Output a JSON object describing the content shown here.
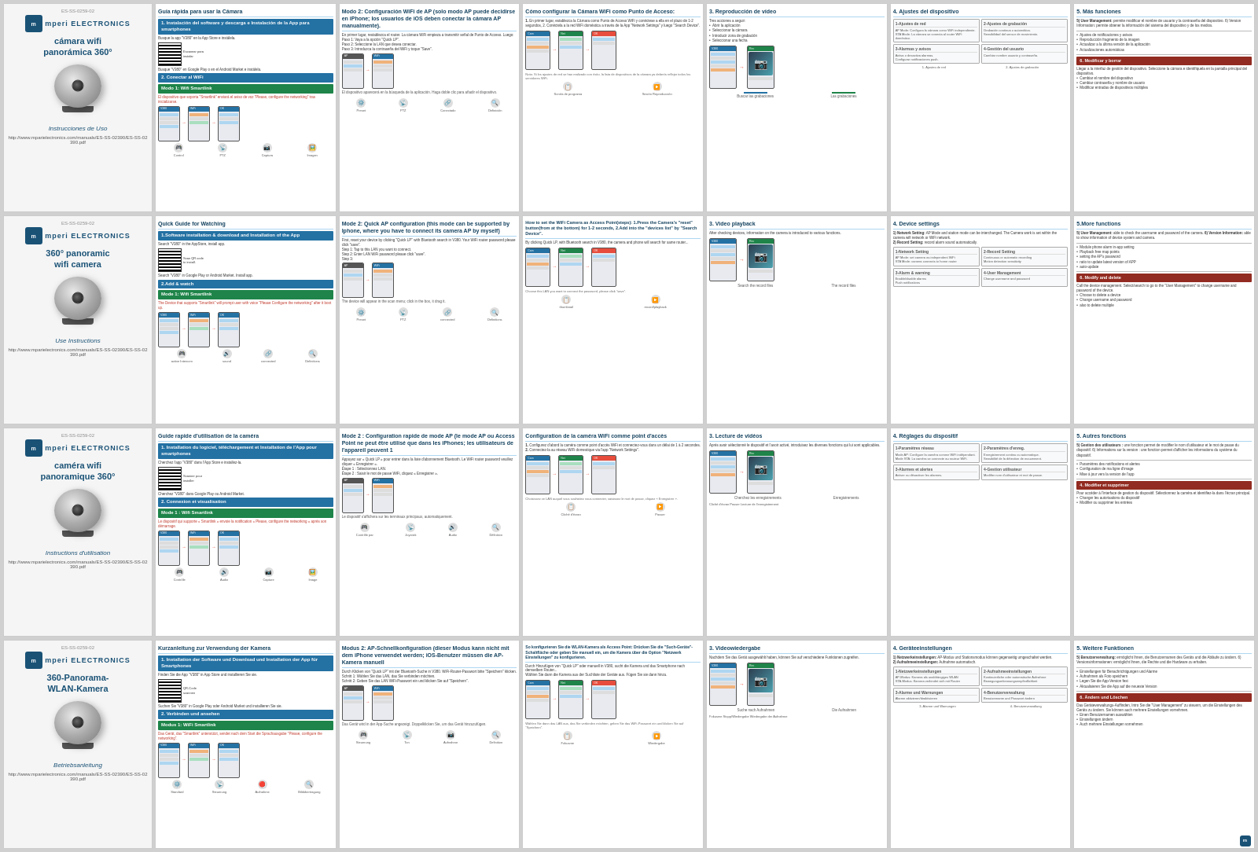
{
  "rows": [
    {
      "id": "row-spanish",
      "camera_panel": {
        "doc_id": "ES-SS-0259-02",
        "logo": "mperi ELECTRONICS",
        "title": "cámara wifi\npanorámica 360°",
        "instructions_label": "Instrucciones de Uso",
        "url": "http://www.mparielectronics.com/manuals/ES-SS-02390/ES-SS-02390.pdf"
      },
      "panels": [
        {
          "id": "panel-es-1",
          "title": "Guía rápida para usar la Cámara",
          "section1": "1. Instalación del software y descarga e Instalación de la App para smartphones",
          "section2": "2. Conectar al WiFi",
          "section3": "Modo 1: Wifi Smartlink",
          "content_type": "installation"
        },
        {
          "id": "panel-es-2",
          "title": "Modo 2: Configuración WiFi de AP (solo modo AP puede decidirse en iPhone; los usuarios de iOS deben conectar la cámara AP manualmente).",
          "content_type": "wifi-config"
        },
        {
          "id": "panel-es-3",
          "title": "Cómo configurar la Cámara WiFi como Punto de Acceso:",
          "content_type": "access-point"
        },
        {
          "id": "panel-es-4",
          "title": "3. Reproducción de vídeo",
          "subsections": [
            "Buscar las grabaciones",
            "Las grabaciones"
          ],
          "content_type": "video-playback"
        },
        {
          "id": "panel-es-5",
          "title": "4. Ajustes del dispositivo",
          "subsections": [
            "1-Ajustes de red",
            "2-Ajustes de grabación",
            "3-Alarmas y avisos",
            "4-Gestión del usuario"
          ],
          "content_type": "device-settings"
        },
        {
          "id": "panel-es-6",
          "title": "5. Más funciones",
          "content_type": "more-functions"
        }
      ]
    },
    {
      "id": "row-english",
      "camera_panel": {
        "doc_id": "ES-SS-0259-02",
        "logo": "mperi ELECTRONICS",
        "title": "360° panoramic\nwifi camera",
        "instructions_label": "Use Instructions",
        "url": "http://www.mparielectronics.com/manuals/ES-SS-02390/ES-SS-02390.pdf"
      },
      "panels": [
        {
          "id": "panel-en-1",
          "title": "Quick Guide for Watching",
          "section1": "1.Software installation & download and Installation of the App",
          "section2": "2.Add & watch",
          "section3": "Mode 1: Wifi Smartlink",
          "content_type": "installation-en"
        },
        {
          "id": "panel-en-2",
          "title": "Mode 2: Quick AP configuration (this mode can be supported by Iphone, where you have to connect its camera AP by myself)",
          "content_type": "wifi-config-en"
        },
        {
          "id": "panel-en-3",
          "title": "How to set the WiFi Camera as Access Point(steps): 1.Press the Camera's \"reset\" button(from at the bottom) for 1-2 seconds,  2.Add into the \"devices list\" by \"Search Device\".",
          "content_type": "access-point-en"
        },
        {
          "id": "panel-en-4",
          "title": "3. Video playback",
          "subsections": [
            "Search the record files",
            "The record files"
          ],
          "content_type": "video-playback-en"
        },
        {
          "id": "panel-en-5",
          "title": "4. Device settings",
          "subsections": [
            "1-Network Setting",
            "2-Record Setting",
            "3-Alarm & warning",
            "4-User Management"
          ],
          "content_type": "device-settings-en"
        },
        {
          "id": "panel-en-6",
          "title": "5.More functions",
          "content_type": "more-functions-en"
        }
      ]
    },
    {
      "id": "row-french",
      "camera_panel": {
        "doc_id": "ES-SS-0259-02",
        "logo": "mperi ELECTRONICS",
        "title": "caméra wifi\npanoramique 360°",
        "instructions_label": "Instructions d'utilisation",
        "url": "http://www.mparielectronics.com/manuals/ES-SS-02390/ES-SS-02390.pdf"
      },
      "panels": [
        {
          "id": "panel-fr-1",
          "title": "Guide rapide d'utilisation de la caméra",
          "section1": "1. Installation du logiciel, téléchargement et Installation de l'App pour smartphones",
          "section2": "2. Connexion et visualisation",
          "section3": "Mode 1 : Wifi Smartlink",
          "content_type": "installation-fr"
        },
        {
          "id": "panel-fr-2",
          "title": "Mode 2 : Configuration rapide de mode AP (le mode AP ou Access Point ne peut être utilisé que dans les iPhones; les utilisateurs de l'appareil peuvent 1",
          "content_type": "wifi-config-fr"
        },
        {
          "id": "panel-fr-3",
          "title": "Configuration de la caméra WiFi comme point d'accès",
          "content_type": "access-point-fr"
        },
        {
          "id": "panel-fr-4",
          "title": "3. Lecture de vidéos",
          "subsections": [
            "Cherchez les enregistrements",
            "Enregistrements"
          ],
          "content_type": "video-playback-fr"
        },
        {
          "id": "panel-fr-5",
          "title": "4. Réglages du dispositif",
          "subsections": [
            "1-Paramètres réseau",
            "2-Paramètres d'enregistrement",
            "3-Alarmes et alertes",
            "4-Gestion de l'utilisateur"
          ],
          "content_type": "device-settings-fr"
        },
        {
          "id": "panel-fr-6",
          "title": "5. Autres fonctions",
          "content_type": "more-functions-fr"
        }
      ]
    },
    {
      "id": "row-german",
      "camera_panel": {
        "doc_id": "ES-SS-0259-02",
        "logo": "mperi ELECTRONICS",
        "title": "360-Panorama-\nWLAN-Kamera",
        "instructions_label": "Betriebsanleitung",
        "url": "http://www.mparielectronics.com/manuals/ES-SS-02390/ES-SS-02390.pdf"
      },
      "panels": [
        {
          "id": "panel-de-1",
          "title": "Kurzanleitung zur Verwendung der Kamera",
          "section1": "1. Installation der Software und Download und Installation der App für Smartphones",
          "section2": "2. Verbinden und ansehen",
          "section3": "Modus 1: WiFi Smartlink",
          "content_type": "installation-de"
        },
        {
          "id": "panel-de-2",
          "title": "Modus 2: AP-Schnellkonfiguration (dieser Modus kann nicht mit dem iPhone verwendet werden; iOS-Benutzer müssen die AP-Kamera manuell",
          "content_type": "wifi-config-de"
        },
        {
          "id": "panel-de-3",
          "title": "So konfigurieren Sie die WLAN-Kamera als Access Point: Drücken Sie die \"Such-Geräte\"-Schaltfläche oder geben Sie manuell ein, um die Kamera über die Option \"Netzwerk Einstellungen\" zu konfigurieren.",
          "content_type": "access-point-de"
        },
        {
          "id": "panel-de-4",
          "title": "3. Videowiedergabe",
          "subsections": [
            "Suche nach Aufnahmen",
            "Die Aufnahmen"
          ],
          "content_type": "video-playback-de"
        },
        {
          "id": "panel-de-5",
          "title": "4. Geräteeinstellungen",
          "subsections": [
            "1-Netzwerkeinstellungen",
            "2-Aufnahmeeinstellungen",
            "3-Alarme und Warnungen",
            "4-Benutzerverwaltung"
          ],
          "content_type": "device-settings-de"
        },
        {
          "id": "panel-de-6",
          "title": "5. Weitere Funktionen",
          "content_type": "more-functions-de"
        }
      ]
    }
  ]
}
